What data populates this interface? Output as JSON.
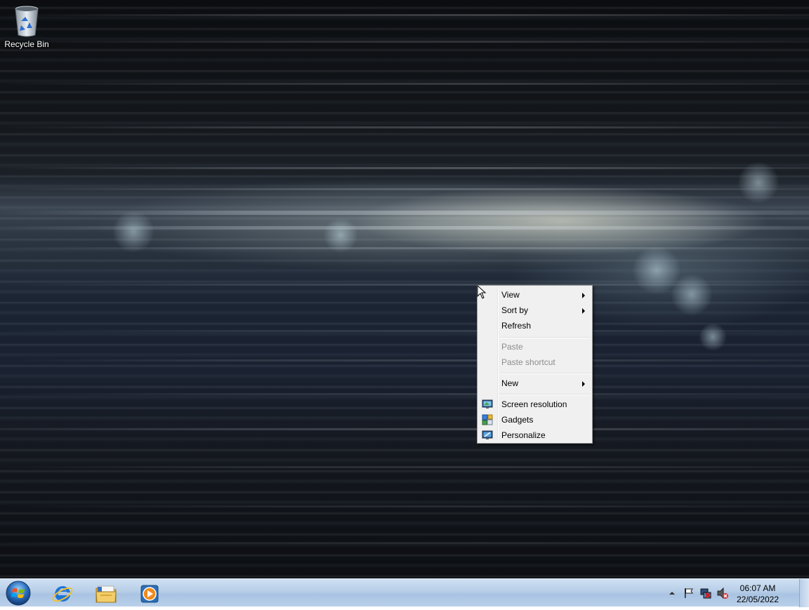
{
  "desktop": {
    "icons": [
      {
        "label": "Recycle Bin",
        "icon": "recycle-bin-icon"
      }
    ]
  },
  "context_menu": {
    "items": [
      {
        "label": "View",
        "has_submenu": true,
        "enabled": true
      },
      {
        "label": "Sort by",
        "has_submenu": true,
        "enabled": true
      },
      {
        "label": "Refresh",
        "has_submenu": false,
        "enabled": true
      },
      {
        "label": "Paste",
        "has_submenu": false,
        "enabled": false
      },
      {
        "label": "Paste shortcut",
        "has_submenu": false,
        "enabled": false
      },
      {
        "label": "New",
        "has_submenu": true,
        "enabled": true
      },
      {
        "label": "Screen resolution",
        "icon": "monitor-icon",
        "enabled": true
      },
      {
        "label": "Gadgets",
        "icon": "gadgets-icon",
        "enabled": true
      },
      {
        "label": "Personalize",
        "icon": "personalize-icon",
        "enabled": true
      }
    ]
  },
  "taskbar": {
    "start_icon": "windows-orb-icon",
    "pinned": [
      {
        "icon": "internet-explorer-icon"
      },
      {
        "icon": "windows-explorer-icon"
      },
      {
        "icon": "media-player-icon"
      }
    ],
    "tray": {
      "icons": [
        "show-hidden-icons-arrow",
        "action-center-flag-icon",
        "network-disconnected-icon",
        "volume-muted-icon"
      ],
      "time": "06:07 AM",
      "date": "22/05/2022"
    }
  },
  "colors": {
    "menu_background": "#f0f0f0",
    "taskbar": "#b9d0ea",
    "disabled_text": "#8d8d8d"
  }
}
